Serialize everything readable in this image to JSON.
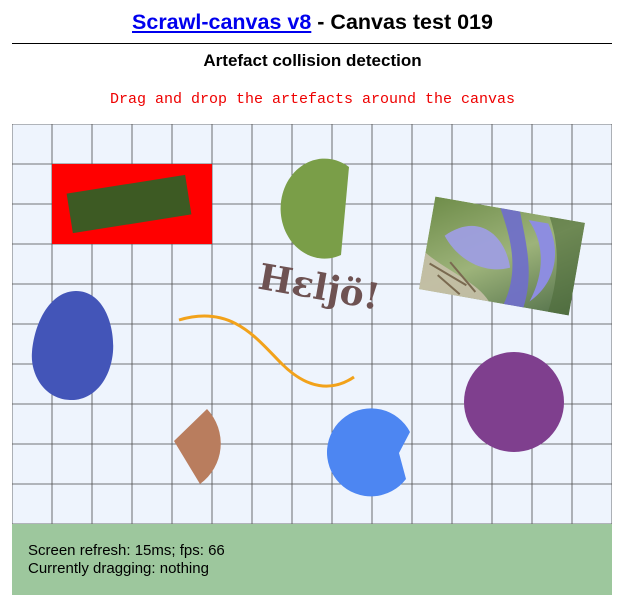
{
  "header": {
    "link_text": "Scrawl-canvas v8",
    "title_suffix": " - Canvas test 019",
    "subtitle": "Artefact collision detection",
    "instruction": "Drag and drop the artefacts around the canvas"
  },
  "canvas": {
    "background_color": "#eef4fd",
    "grid_color": "#4a4a4a",
    "artefacts": {
      "red_block_color": "#ff0000",
      "dark_block_color": "#3d5a23",
      "green_shape_color": "#7a9e48",
      "heljo_text": "Hɛljö!",
      "heljo_color": "#6e5252",
      "image_label": "iris flower photo",
      "blue_blob_color": "#4355b8",
      "orange_line_color": "#f2a21a",
      "purple_circle_color": "#7f3f8e",
      "brown_wedge_color": "#b97d5e",
      "pacman_color": "#4d86f2"
    }
  },
  "report": {
    "refresh_line": "Screen refresh: 15ms; fps: 66",
    "dragging_line": "Currently dragging: nothing",
    "background_color": "#9dc79d"
  }
}
